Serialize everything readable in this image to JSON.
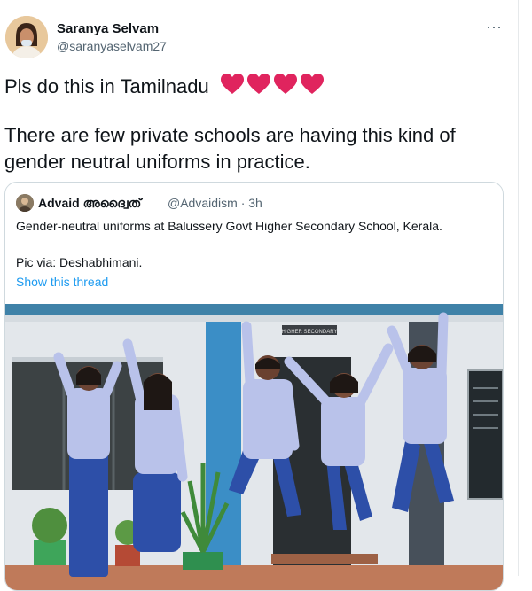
{
  "author": {
    "display_name": "Saranya Selvam",
    "handle": "@saranyaselvam27"
  },
  "more_menu_glyph": "···",
  "tweet": {
    "line1": "Pls do this in Tamilnadu",
    "line2": "There are few private schools are having this kind of gender neutral uniforms in practice.",
    "heart_count": 4,
    "heart_color": "#e0245e"
  },
  "quoted_tweet": {
    "display_name": "Advaid അദ്വൈത്",
    "handle": "@Advaidism",
    "separator": "·",
    "age": "3h",
    "text": "Gender-neutral uniforms at Balussery Govt Higher Secondary School, Kerala.",
    "credit": "Pic via: Deshabhimani.",
    "show_thread": "Show this thread"
  },
  "photo": {
    "sign_text": "HIGHER SECONDARY"
  },
  "colors": {
    "link": "#1d9bf0",
    "secondary_text": "#536471",
    "border": "#cfd9de",
    "uniform_shirt": "#b9c2ea",
    "uniform_pants": "#2d4fa8",
    "wall": "#e2e6ea",
    "roof_band": "#3f82a8"
  }
}
